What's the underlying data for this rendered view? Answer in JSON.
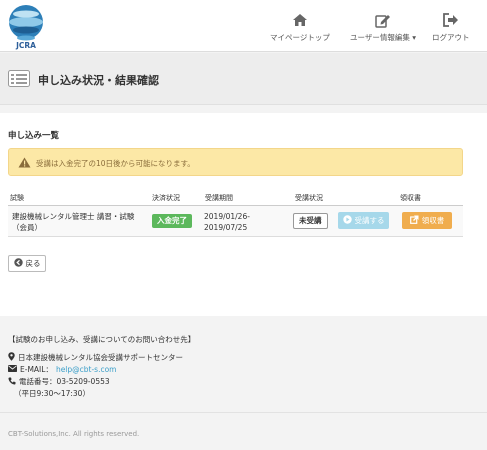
{
  "brand": {
    "logo_text": "JCRA"
  },
  "nav": {
    "mypage": "マイページトップ",
    "user_edit": "ユーザー情報編集",
    "logout": "ログアウト"
  },
  "page": {
    "title": "申し込み状況・結果確認"
  },
  "section": {
    "title": "申し込み一覧",
    "alert": "受講は入金完了の10日後から可能になります。"
  },
  "table": {
    "headers": [
      "試験",
      "決済状況",
      "受講期間",
      "受講状況",
      "領収書"
    ],
    "rows": [
      {
        "exam": "建設機械レンタル管理士 講習・試験（会員）",
        "payment": "入金完了",
        "period_start": "2019/01/26-",
        "period_end": "2019/07/25",
        "attend_status": "未受講",
        "attend_button": "受講する",
        "receipt_button": "領収書"
      }
    ]
  },
  "back_button": "戻る",
  "footer": {
    "contact_title": "【試験のお申し込み、受講についてのお問い合わせ先】",
    "org": "日本建設機械レンタル協会受講サポートセンター",
    "email_label": "E-MAIL：",
    "email": "help@cbt-s.com",
    "phone": "電話番号：03-5209-0553",
    "hours": "（平日9:30〜17:30）",
    "copyright": "CBT-Solutions,Inc. All rights reserved."
  },
  "colors": {
    "paid_badge": "#5cb85c",
    "attend_button": "#a6d8ea",
    "receipt_button": "#f0ad4e",
    "alert_bg": "#fce8a6",
    "link": "#3c9fc9"
  },
  "icons": [
    "home-icon",
    "edit-icon",
    "logout-icon",
    "list-icon",
    "warning-icon",
    "play-circle-icon",
    "external-link-icon",
    "back-arrow-icon",
    "map-marker-icon",
    "envelope-icon",
    "phone-icon"
  ]
}
